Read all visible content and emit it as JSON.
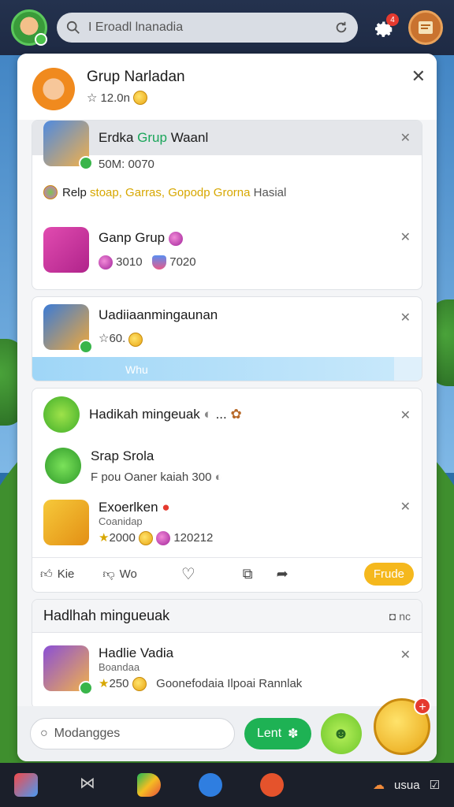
{
  "search": {
    "text": "I Eroadl lnanadia"
  },
  "top": {
    "notif_count": "4"
  },
  "panel": {
    "title": "Grup Narladan",
    "subtitle": "12.0n"
  },
  "group1": {
    "name_prefix": "Erdka",
    "name_green": "Grup",
    "name_suffix": "Waanl",
    "meta": "50M: 0070"
  },
  "help": {
    "prefix": "Relp",
    "yellow": "stoap, Garras, Gopodp Grorna",
    "suffix": "Hasial"
  },
  "group2": {
    "name": "Ganp Grup",
    "val1": "3010",
    "val2": "7020"
  },
  "card2": {
    "name": "Uadiiaanmingaunan",
    "sub": "60.",
    "progress_label": "Whu",
    "progress": 0.93
  },
  "card3": {
    "header": "Hadikah mingeuak",
    "header_suffix": "...",
    "item1": {
      "name": "Srap Srola",
      "meta": "F pou Oaner kaiah 300"
    },
    "item2": {
      "name": "Exoerlken",
      "sub": "Coanidap",
      "val1": "2000",
      "val2": "120212"
    }
  },
  "actions": {
    "like": "Kie",
    "dislike": "Wo",
    "pill": "Frude"
  },
  "card4": {
    "header": "Hadlhah mingueuak",
    "header_right": "nc",
    "item": {
      "name": "Hadlie Vadia",
      "sub": "Boandaa",
      "val": "250",
      "meta": "Goonefodaia Ilpoai Rannlak"
    }
  },
  "bottom": {
    "input_placeholder": "Modangges",
    "send_label": "Lent"
  },
  "navbar": {
    "right_text": "usua"
  }
}
